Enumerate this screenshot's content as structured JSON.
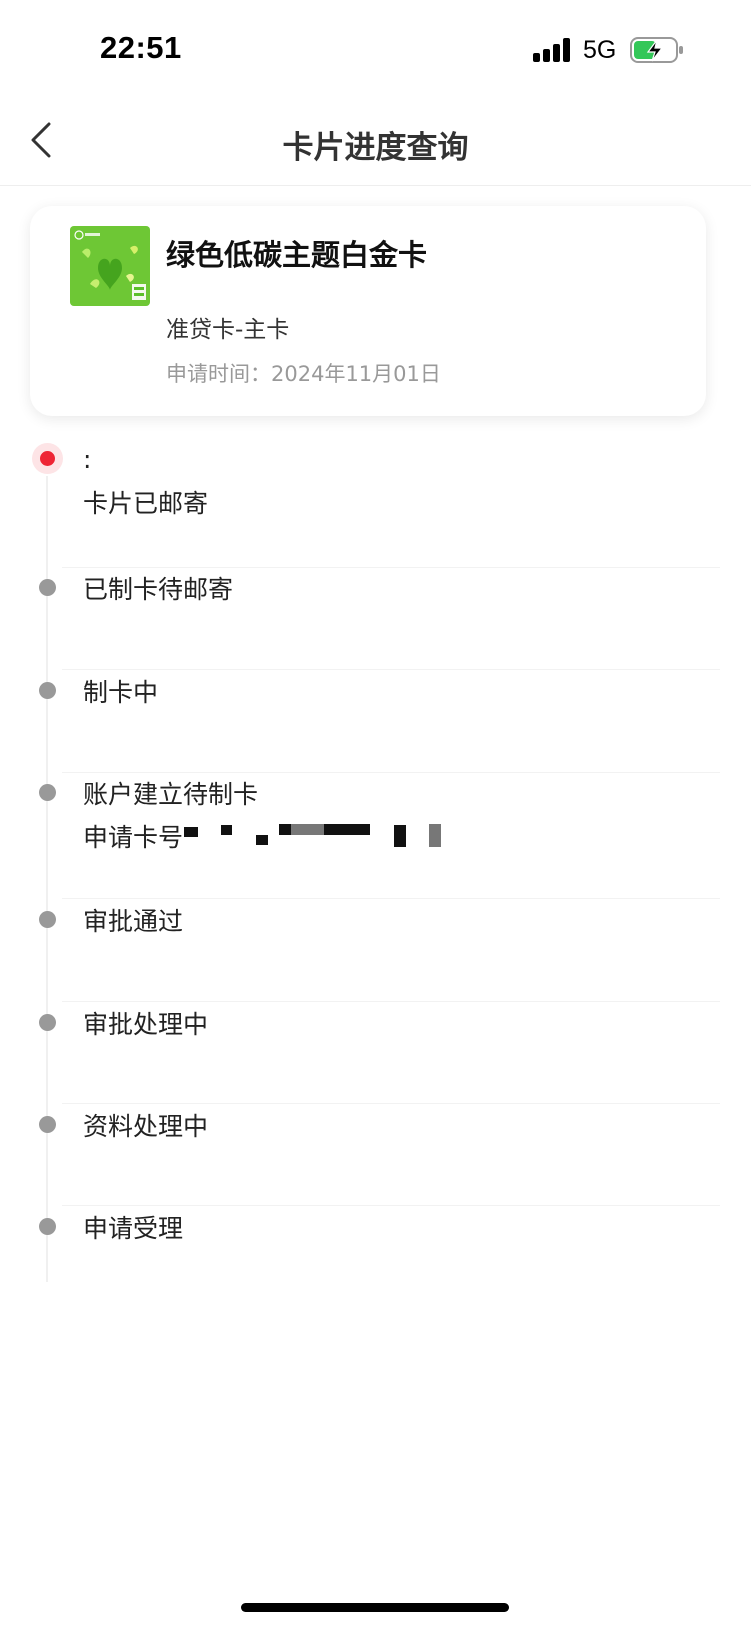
{
  "status_bar": {
    "time": "22:51",
    "network": "5G",
    "battery_color": "#34c759"
  },
  "nav": {
    "title": "卡片进度查询",
    "back_icon": "chevron-left-icon"
  },
  "card": {
    "name": "绿色低碳主题白金卡",
    "type": "准贷卡-主卡",
    "apply_time": "申请时间：2024年11月01日",
    "thumbnail_color": "#5cbf2a"
  },
  "timeline": {
    "steps": [
      {
        "time": ":",
        "status": "卡片已邮寄",
        "active": true
      },
      {
        "status": "已制卡待邮寄"
      },
      {
        "status": "制卡中"
      },
      {
        "status": "账户建立待制卡",
        "detail": "申请卡号"
      },
      {
        "status": "审批通过"
      },
      {
        "status": "审批处理中"
      },
      {
        "status": "资料处理中"
      },
      {
        "status": "申请受理"
      }
    ],
    "active_color": "#ee2535",
    "inactive_color": "#999999"
  }
}
